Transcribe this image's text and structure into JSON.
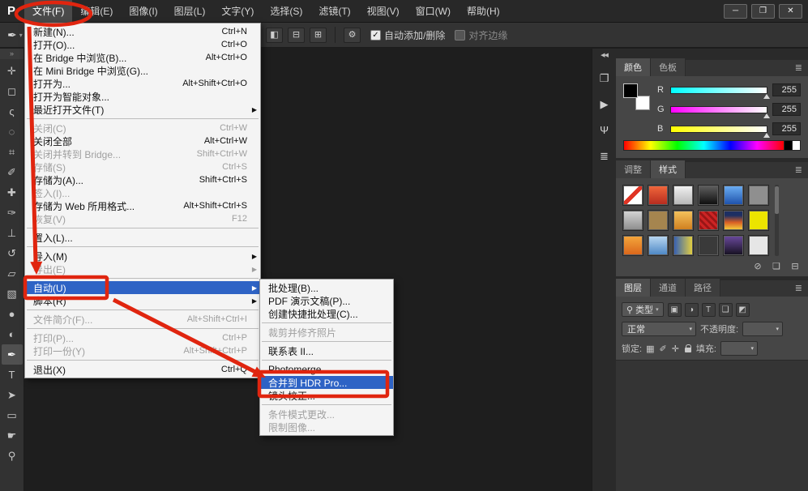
{
  "app": {
    "logo": "P"
  },
  "ui": {
    "caret": "▾",
    "submenu_arrow": "▶"
  },
  "annotations": {
    "color": "#e0250f"
  },
  "window_controls": [
    {
      "name": "minimize-button",
      "glyph": "─"
    },
    {
      "name": "restore-button",
      "glyph": "❐"
    },
    {
      "name": "close-button",
      "glyph": "✕"
    }
  ],
  "menubar": {
    "items": [
      {
        "key": "file",
        "label": "文件(F)",
        "open": true
      },
      {
        "key": "edit",
        "label": "编辑(E)"
      },
      {
        "key": "image",
        "label": "图像(I)"
      },
      {
        "key": "layer",
        "label": "图层(L)"
      },
      {
        "key": "type",
        "label": "文字(Y)"
      },
      {
        "key": "select",
        "label": "选择(S)"
      },
      {
        "key": "filter",
        "label": "滤镜(T)"
      },
      {
        "key": "view",
        "label": "视图(V)"
      },
      {
        "key": "window",
        "label": "窗口(W)"
      },
      {
        "key": "help",
        "label": "帮助(H)"
      }
    ]
  },
  "options_bar": {
    "tool_glyph": "✒",
    "check_glyph": "✓",
    "gear_glyph": "⚙",
    "icons": [
      {
        "name": "path-operations-icon",
        "glyph": "◧"
      },
      {
        "name": "path-alignment-icon",
        "glyph": "⊟"
      },
      {
        "name": "path-arrangement-icon",
        "glyph": "⊞"
      }
    ],
    "checkboxes": [
      {
        "name": "auto-add-delete",
        "label": "自动添加/删除",
        "checked": true
      },
      {
        "name": "align-edges",
        "label": "对齐边缘",
        "checked": false
      }
    ]
  },
  "tools": {
    "collapse_glyph": "»",
    "active": "pen-tool",
    "items": [
      {
        "name": "move-tool",
        "glyph": "✛"
      },
      {
        "name": "marquee-tool",
        "glyph": "◻"
      },
      {
        "name": "lasso-tool",
        "glyph": "ς"
      },
      {
        "name": "quick-selection-tool",
        "glyph": "◌"
      },
      {
        "name": "crop-tool",
        "glyph": "⌗"
      },
      {
        "name": "eyedropper-tool",
        "glyph": "✐"
      },
      {
        "name": "healing-brush-tool",
        "glyph": "✚"
      },
      {
        "name": "brush-tool",
        "glyph": "✑"
      },
      {
        "name": "clone-stamp-tool",
        "glyph": "⊥"
      },
      {
        "name": "history-brush-tool",
        "glyph": "↺"
      },
      {
        "name": "eraser-tool",
        "glyph": "▱"
      },
      {
        "name": "gradient-tool",
        "glyph": "▧"
      },
      {
        "name": "blur-tool",
        "glyph": "●"
      },
      {
        "name": "dodge-tool",
        "glyph": "◐"
      },
      {
        "name": "pen-tool",
        "glyph": "✒"
      },
      {
        "name": "type-tool",
        "glyph": "T"
      },
      {
        "name": "path-selection-tool",
        "glyph": "➤"
      },
      {
        "name": "shape-tool",
        "glyph": "▭"
      },
      {
        "name": "hand-tool",
        "glyph": "☛"
      },
      {
        "name": "zoom-tool",
        "glyph": "⚲"
      }
    ]
  },
  "file_menu": {
    "items": [
      {
        "name": "new",
        "label": "新建(N)...",
        "shortcut": "Ctrl+N"
      },
      {
        "name": "open",
        "label": "打开(O)...",
        "shortcut": "Ctrl+O"
      },
      {
        "name": "browse-in-bridge",
        "label": "在 Bridge 中浏览(B)...",
        "shortcut": "Alt+Ctrl+O"
      },
      {
        "name": "browse-in-mini-bridge",
        "label": "在 Mini Bridge 中浏览(G)..."
      },
      {
        "name": "open-as",
        "label": "打开为...",
        "shortcut": "Alt+Shift+Ctrl+O"
      },
      {
        "name": "open-as-smart-object",
        "label": "打开为智能对象..."
      },
      {
        "name": "open-recent",
        "label": "最近打开文件(T)",
        "submenu": true
      },
      {
        "separator": true
      },
      {
        "name": "close",
        "label": "关闭(C)",
        "shortcut": "Ctrl+W",
        "disabled": true
      },
      {
        "name": "close-all",
        "label": "关闭全部",
        "shortcut": "Alt+Ctrl+W"
      },
      {
        "name": "close-and-go-to-bridge",
        "label": "关闭并转到 Bridge...",
        "shortcut": "Shift+Ctrl+W",
        "disabled": true
      },
      {
        "name": "save",
        "label": "存储(S)",
        "shortcut": "Ctrl+S",
        "disabled": true
      },
      {
        "name": "save-as",
        "label": "存储为(A)...",
        "shortcut": "Shift+Ctrl+S"
      },
      {
        "name": "check-in",
        "label": "签入(I)...",
        "disabled": true
      },
      {
        "name": "save-for-web",
        "label": "存储为 Web 所用格式...",
        "shortcut": "Alt+Shift+Ctrl+S"
      },
      {
        "name": "revert",
        "label": "恢复(V)",
        "shortcut": "F12",
        "disabled": true
      },
      {
        "separator": true
      },
      {
        "name": "place",
        "label": "置入(L)..."
      },
      {
        "separator": true
      },
      {
        "name": "import",
        "label": "导入(M)",
        "submenu": true
      },
      {
        "name": "export",
        "label": "导出(E)",
        "submenu": true,
        "disabled": true
      },
      {
        "separator": true
      },
      {
        "name": "automate",
        "label": "自动(U)",
        "submenu": true,
        "highlight": true
      },
      {
        "name": "scripts",
        "label": "脚本(R)",
        "submenu": true
      },
      {
        "separator": true
      },
      {
        "name": "file-info",
        "label": "文件简介(F)...",
        "shortcut": "Alt+Shift+Ctrl+I",
        "disabled": true
      },
      {
        "separator": true
      },
      {
        "name": "print",
        "label": "打印(P)...",
        "shortcut": "Ctrl+P",
        "disabled": true
      },
      {
        "name": "print-one-copy",
        "label": "打印一份(Y)",
        "shortcut": "Alt+Shift+Ctrl+P",
        "disabled": true
      },
      {
        "separator": true
      },
      {
        "name": "exit",
        "label": "退出(X)",
        "shortcut": "Ctrl+Q"
      }
    ]
  },
  "automate_submenu": {
    "items": [
      {
        "name": "batch",
        "label": "批处理(B)..."
      },
      {
        "name": "pdf-presentation",
        "label": "PDF 演示文稿(P)..."
      },
      {
        "name": "create-droplet",
        "label": "创建快捷批处理(C)..."
      },
      {
        "separator": true
      },
      {
        "name": "crop-and-straighten",
        "label": "裁剪并修齐照片",
        "disabled": true
      },
      {
        "separator": true
      },
      {
        "name": "contact-sheet",
        "label": "联系表 II..."
      },
      {
        "separator": true
      },
      {
        "name": "photomerge",
        "label": "Photomerge..."
      },
      {
        "name": "merge-to-hdr-pro",
        "label": "合并到 HDR Pro...",
        "highlight": true
      },
      {
        "name": "lens-correction",
        "label": "镜头校正..."
      },
      {
        "separator": true
      },
      {
        "name": "conditional-mode-change",
        "label": "条件模式更改...",
        "disabled": true
      },
      {
        "name": "fit-image",
        "label": "限制图像...",
        "disabled": true
      }
    ]
  },
  "dock_strip": {
    "collapse_glyph": "◀◀",
    "icons": [
      {
        "name": "mini-bridge-panel-icon",
        "glyph": "❐"
      },
      {
        "name": "actions-panel-icon",
        "glyph": "▶"
      },
      {
        "name": "brush-presets-panel-icon",
        "glyph": "Ψ"
      },
      {
        "name": "clone-source-panel-icon",
        "glyph": "≣"
      }
    ]
  },
  "color_panel": {
    "tabs": [
      {
        "key": "color",
        "label": "颜色",
        "active": true
      },
      {
        "key": "swatches",
        "label": "色板"
      }
    ],
    "menu_icon": "≣",
    "sliders": [
      {
        "label": "R",
        "value": "255",
        "gradient": "linear-gradient(90deg,#00ffff,#ffffff)"
      },
      {
        "label": "G",
        "value": "255",
        "gradient": "linear-gradient(90deg,#ff00ff,#ffffff)"
      },
      {
        "label": "B",
        "value": "255",
        "gradient": "linear-gradient(90deg,#ffff00,#ffffff)"
      }
    ],
    "spectrum_gradient": "linear-gradient(90deg,#ff0000,#ffff00,#00ff00,#00ffff,#0000ff,#ff00ff,#ff0000)"
  },
  "styles_panel": {
    "tabs": [
      {
        "key": "adjustments",
        "label": "调整"
      },
      {
        "key": "styles",
        "label": "样式",
        "active": true
      }
    ],
    "menu_icon": "≣",
    "swatches": [
      {
        "name": "style-none",
        "bg": "linear-gradient(135deg,#ffffff 42%,#e03424 42%,#e03424 58%,#ffffff 58%)"
      },
      {
        "name": "style-red-gradient",
        "bg": "linear-gradient(#f2683c,#b52a1e)"
      },
      {
        "name": "style-silver-bevel",
        "bg": "linear-gradient(#f2f2f2,#b5b5b5)"
      },
      {
        "name": "style-black-glossy",
        "bg": "linear-gradient(#606060,#0c0c0c)"
      },
      {
        "name": "style-blue-glossy",
        "bg": "linear-gradient(#6db0f5,#1c4fa8)"
      },
      {
        "name": "style-gray-flat",
        "bg": "#8f8f8f"
      },
      {
        "name": "style-silver-gradient",
        "bg": "linear-gradient(#d6d6d6,#8c8c8c)"
      },
      {
        "name": "style-tan",
        "bg": "#a5854f"
      },
      {
        "name": "style-gold",
        "bg": "linear-gradient(#f5c45e,#cf7d1d)"
      },
      {
        "name": "style-red-texture",
        "bg": "repeating-linear-gradient(45deg,#cc2424 0 3px,#991616 3px 6px)"
      },
      {
        "name": "style-sunset",
        "bg": "linear-gradient(#1d2f63 25%,#d95f24 60%,#f5d43d)"
      },
      {
        "name": "style-yellow",
        "bg": "#ece400"
      },
      {
        "name": "style-orange-gradient",
        "bg": "linear-gradient(#f5a83d,#d9641a)"
      },
      {
        "name": "style-sky-gradient",
        "bg": "linear-gradient(#bcd9f2,#4a85c4)"
      },
      {
        "name": "style-blue-yellow",
        "bg": "linear-gradient(90deg,#2f5cb8,#e8d23d)"
      },
      {
        "name": "style-dark-texture",
        "bg": "#3a3a3a"
      },
      {
        "name": "style-purple-dark",
        "bg": "linear-gradient(#6b4a9e,#15101f)"
      },
      {
        "name": "style-white",
        "bg": "#e6e6e6"
      }
    ],
    "footer_icons": [
      {
        "name": "clear-style-icon",
        "glyph": "⊘"
      },
      {
        "name": "new-style-icon",
        "glyph": "❏"
      },
      {
        "name": "delete-style-icon",
        "glyph": "⊟"
      }
    ]
  },
  "layers_panel": {
    "tabs": [
      {
        "key": "layers",
        "label": "图层",
        "active": true
      },
      {
        "key": "channels",
        "label": "通道"
      },
      {
        "key": "paths",
        "label": "路径"
      }
    ],
    "menu_icon": "≣",
    "filter": {
      "pill_icon": "⚲",
      "pill_label": "类型",
      "icons": [
        {
          "name": "filter-pixel-layers-icon",
          "glyph": "▣"
        },
        {
          "name": "filter-adjustment-layers-icon",
          "glyph": "◑"
        },
        {
          "name": "filter-type-layers-icon",
          "glyph": "T"
        },
        {
          "name": "filter-shape-layers-icon",
          "glyph": "❑"
        },
        {
          "name": "filter-smart-objects-icon",
          "glyph": "◩"
        }
      ]
    },
    "blend_mode": {
      "value": "正常"
    },
    "opacity": {
      "label": "不透明度:",
      "value": ""
    },
    "lock": {
      "label": "锁定:",
      "icons": [
        {
          "name": "lock-transparency-icon",
          "glyph": "▦"
        },
        {
          "name": "lock-pixels-icon",
          "glyph": "✐"
        },
        {
          "name": "lock-position-icon",
          "glyph": "✛"
        },
        {
          "name": "lock-all-icon",
          "glyph": "css-lock"
        }
      ]
    },
    "fill": {
      "label": "填充:",
      "value": ""
    }
  }
}
